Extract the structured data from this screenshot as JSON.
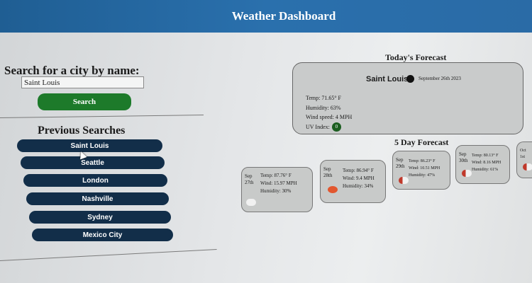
{
  "header": {
    "title": "Weather Dashboard",
    "color": "#2a6ba6"
  },
  "search": {
    "heading": "Search for a city by name:",
    "input_value": "Saint Louis",
    "button_label": "Search",
    "button_color": "#1d7a2a"
  },
  "history": {
    "heading": "Previous Searches",
    "items": [
      "Saint Louis",
      "Seattle",
      "London",
      "Nashville",
      "Sydney",
      "Mexico City"
    ]
  },
  "today": {
    "heading": "Today's Forecast",
    "city": "Saint Louis",
    "date": "September 26th 2023",
    "icon": "moon-icon",
    "temp": "Temp: 71.65° F",
    "humidity": "Humidity: 63%",
    "wind": "Wind speed: 4 MPH",
    "uv_label": "UV Index:",
    "uv_value": "0"
  },
  "forecast": {
    "heading": "5 Day Forecast",
    "days": [
      {
        "date": "Sep 27th",
        "temp": "Temp: 87.76° F",
        "wind": "Wind: 15.97 MPH",
        "humidity": "Humidity: 30%",
        "icon": "cloud-icon"
      },
      {
        "date": "Sep 28th",
        "temp": "Temp: 86.94° F",
        "wind": "Wind: 9.4 MPH",
        "humidity": "Humidity: 34%",
        "icon": "sun-icon"
      },
      {
        "date": "Sep 29th",
        "temp": "Temp: 86.23° F",
        "wind": "Wind: 10.51 MPH",
        "humidity": "Humidity: 47%",
        "icon": "partly-cloudy-icon"
      },
      {
        "date": "Sep 30th",
        "temp": "Temp: 80.13° F",
        "wind": "Wind: 8.16 MPH",
        "humidity": "Humidity: 61%",
        "icon": "partly-cloudy-icon"
      },
      {
        "date": "Oct 1st",
        "temp": "",
        "wind": "",
        "humidity": "",
        "icon": "partly-cloudy-icon"
      }
    ]
  }
}
